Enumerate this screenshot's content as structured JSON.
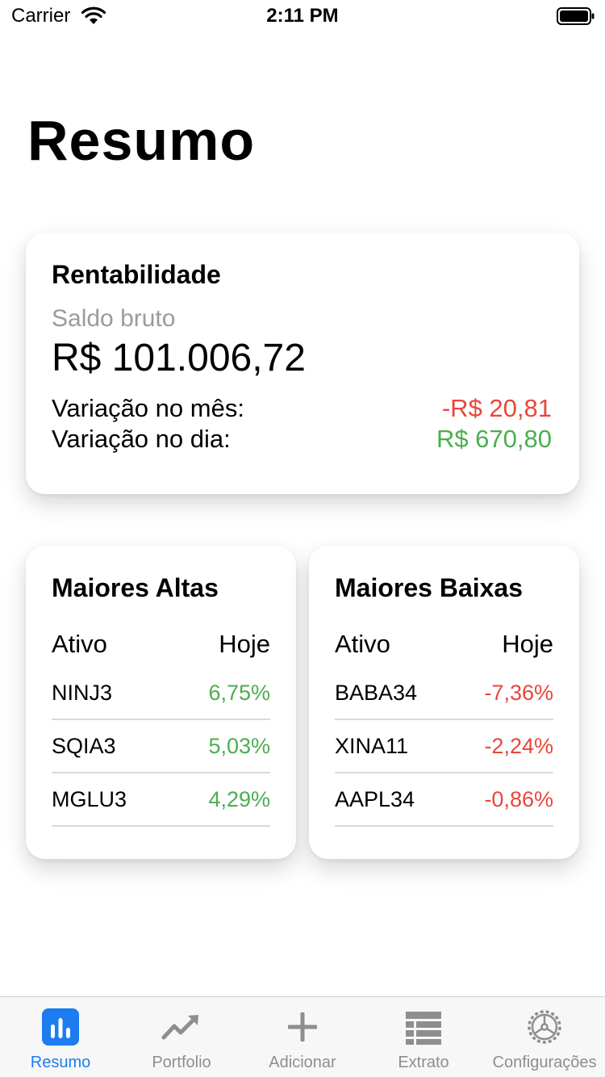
{
  "status_bar": {
    "carrier": "Carrier",
    "time": "2:11 PM"
  },
  "page": {
    "title": "Resumo"
  },
  "rentabilidade": {
    "title": "Rentabilidade",
    "saldo_label": "Saldo bruto",
    "saldo_value": "R$ 101.006,72",
    "variacao_mes_label": "Variação no mês:",
    "variacao_mes_value": "-R$ 20,81",
    "variacao_dia_label": "Variação no dia:",
    "variacao_dia_value": "R$ 670,80"
  },
  "maiores_altas": {
    "title": "Maiores Altas",
    "col_asset": "Ativo",
    "col_today": "Hoje",
    "rows": [
      {
        "asset": "NINJ3",
        "change": "6,75%"
      },
      {
        "asset": "SQIA3",
        "change": "5,03%"
      },
      {
        "asset": "MGLU3",
        "change": "4,29%"
      }
    ]
  },
  "maiores_baixas": {
    "title": "Maiores Baixas",
    "col_asset": "Ativo",
    "col_today": "Hoje",
    "rows": [
      {
        "asset": "BABA34",
        "change": "-7,36%"
      },
      {
        "asset": "XINA11",
        "change": "-2,24%"
      },
      {
        "asset": "AAPL34",
        "change": "-0,86%"
      }
    ]
  },
  "tab_bar": {
    "items": [
      {
        "label": "Resumo",
        "icon": "bar-chart-icon",
        "active": true
      },
      {
        "label": "Portfolio",
        "icon": "trend-up-icon",
        "active": false
      },
      {
        "label": "Adicionar",
        "icon": "plus-icon",
        "active": false
      },
      {
        "label": "Extrato",
        "icon": "list-icon",
        "active": false
      },
      {
        "label": "Configurações",
        "icon": "gear-icon",
        "active": false
      }
    ]
  },
  "colors": {
    "accent": "#1c7cf0",
    "positive": "#4bae4f",
    "negative": "#e9463a",
    "tab_inactive": "#8e8e8e"
  }
}
